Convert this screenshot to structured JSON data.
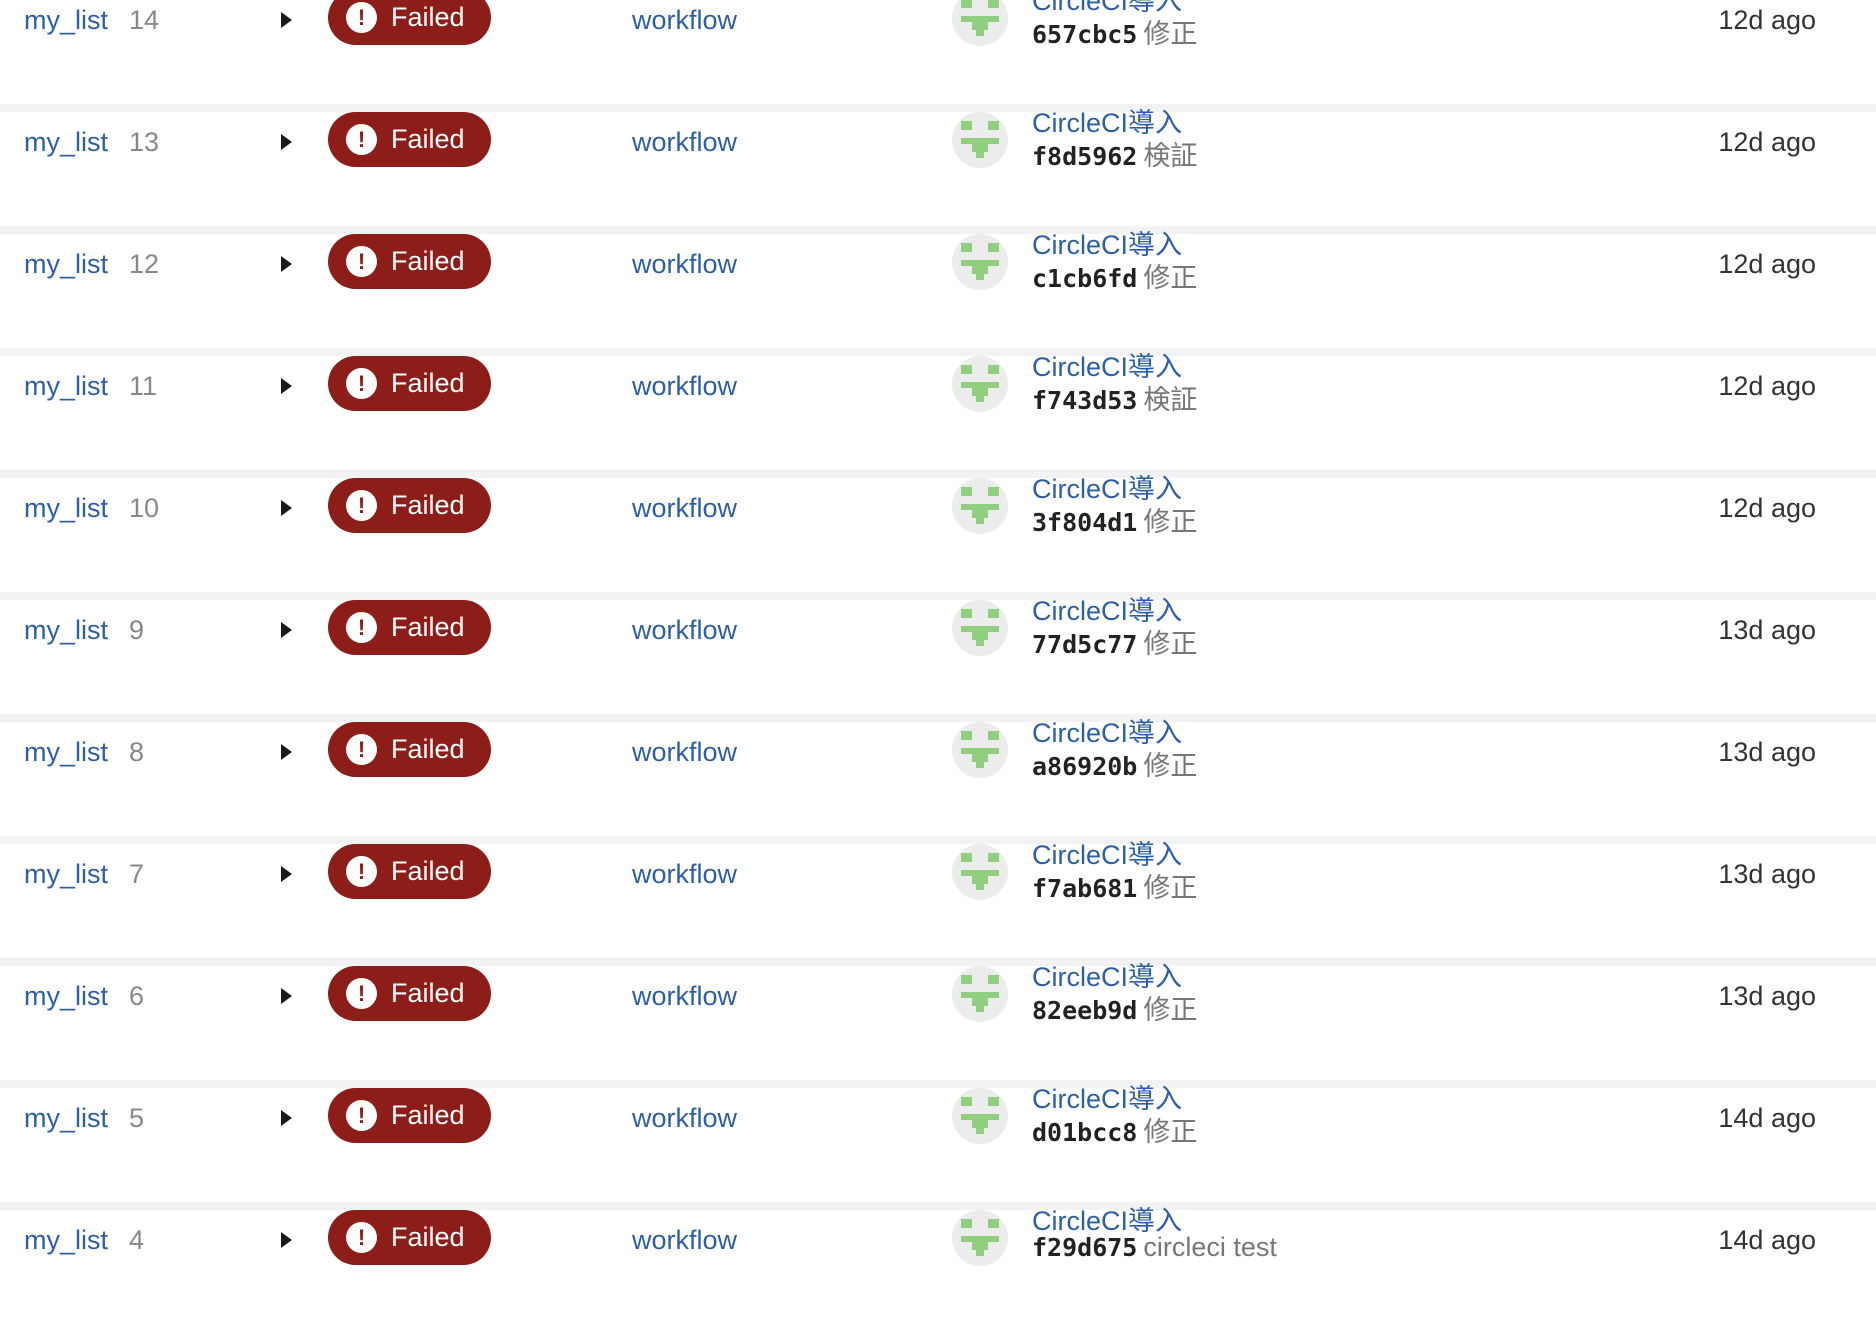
{
  "rows": [
    {
      "project": "my_list",
      "number": "14",
      "status": "Failed",
      "workflow": "workflow",
      "commit_title": "CircleCI導入",
      "commit_hash": "657cbc5",
      "commit_message": "修正",
      "time": "12d ago"
    },
    {
      "project": "my_list",
      "number": "13",
      "status": "Failed",
      "workflow": "workflow",
      "commit_title": "CircleCI導入",
      "commit_hash": "f8d5962",
      "commit_message": "検証",
      "time": "12d ago"
    },
    {
      "project": "my_list",
      "number": "12",
      "status": "Failed",
      "workflow": "workflow",
      "commit_title": "CircleCI導入",
      "commit_hash": "c1cb6fd",
      "commit_message": "修正",
      "time": "12d ago"
    },
    {
      "project": "my_list",
      "number": "11",
      "status": "Failed",
      "workflow": "workflow",
      "commit_title": "CircleCI導入",
      "commit_hash": "f743d53",
      "commit_message": "検証",
      "time": "12d ago"
    },
    {
      "project": "my_list",
      "number": "10",
      "status": "Failed",
      "workflow": "workflow",
      "commit_title": "CircleCI導入",
      "commit_hash": "3f804d1",
      "commit_message": "修正",
      "time": "12d ago"
    },
    {
      "project": "my_list",
      "number": "9",
      "status": "Failed",
      "workflow": "workflow",
      "commit_title": "CircleCI導入",
      "commit_hash": "77d5c77",
      "commit_message": "修正",
      "time": "13d ago"
    },
    {
      "project": "my_list",
      "number": "8",
      "status": "Failed",
      "workflow": "workflow",
      "commit_title": "CircleCI導入",
      "commit_hash": "a86920b",
      "commit_message": "修正",
      "time": "13d ago"
    },
    {
      "project": "my_list",
      "number": "7",
      "status": "Failed",
      "workflow": "workflow",
      "commit_title": "CircleCI導入",
      "commit_hash": "f7ab681",
      "commit_message": "修正",
      "time": "13d ago"
    },
    {
      "project": "my_list",
      "number": "6",
      "status": "Failed",
      "workflow": "workflow",
      "commit_title": "CircleCI導入",
      "commit_hash": "82eeb9d",
      "commit_message": "修正",
      "time": "13d ago"
    },
    {
      "project": "my_list",
      "number": "5",
      "status": "Failed",
      "workflow": "workflow",
      "commit_title": "CircleCI導入",
      "commit_hash": "d01bcc8",
      "commit_message": "修正",
      "time": "14d ago"
    },
    {
      "project": "my_list",
      "number": "4",
      "status": "Failed",
      "workflow": "workflow",
      "commit_title": "CircleCI導入",
      "commit_hash": "f29d675",
      "commit_message": "circleci test",
      "time": "14d ago"
    }
  ],
  "status_icon": "exclamation-icon",
  "colors": {
    "failed_badge": "#8c1d18",
    "link": "#2c5fa8",
    "avatar_identicon": "#8fcf7f",
    "row_separator": "#f2f2f2"
  }
}
